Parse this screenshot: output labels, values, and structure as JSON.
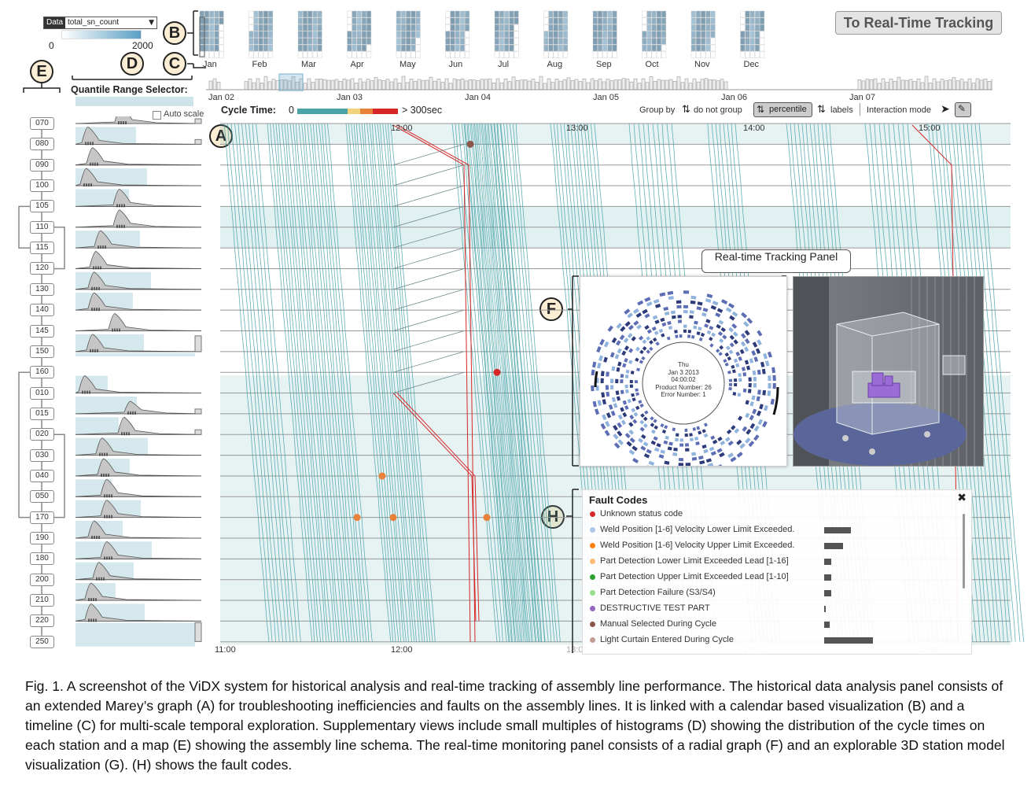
{
  "data_selector": {
    "tag": "Data",
    "value": "total_sn_count",
    "min": "0",
    "max": "2000"
  },
  "callouts": {
    "A": "A",
    "B": "B",
    "C": "C",
    "D": "D",
    "E": "E",
    "F": "F",
    "G": "G",
    "H": "H"
  },
  "realtime_button": "To Real-Time Tracking",
  "months": [
    "Jan",
    "Feb",
    "Mar",
    "Apr",
    "May",
    "Jun",
    "Jul",
    "Aug",
    "Sep",
    "Oct",
    "Nov",
    "Dec"
  ],
  "timeline_days": [
    "Jan 02",
    "Jan 03",
    "Jan 04",
    "Jan 05",
    "Jan 06",
    "Jan 07"
  ],
  "quantile_label": "Quantile Range Selector:",
  "auto_scale": "Auto scale",
  "cycle_time": {
    "label": "Cycle Time:",
    "min": "0",
    "max": "> 300sec",
    "colors": [
      "#4ba3a8",
      "#f2d27a",
      "#e8823a",
      "#d62728"
    ]
  },
  "toolbar": {
    "group_by": "Group by",
    "do_not_group": "do not group",
    "percentile": "percentile",
    "labels": "labels",
    "interaction_mode": "Interaction mode"
  },
  "hours_top": [
    "12:00",
    "13:00",
    "14:00",
    "15:00"
  ],
  "hours_bottom": [
    "11:00",
    "12:00",
    "13:00",
    "14:00",
    "15:00"
  ],
  "stations": [
    "070",
    "080",
    "090",
    "100",
    "105",
    "110",
    "115",
    "120",
    "130",
    "140",
    "145",
    "150",
    "160",
    "010",
    "015",
    "020",
    "030",
    "040",
    "050",
    "170",
    "190",
    "180",
    "200",
    "210",
    "220",
    "250"
  ],
  "realtime_panel_title": "Real-time Tracking Panel",
  "radial_center": {
    "day": "Thu",
    "date": "Jan 3 2013",
    "time": "04:00:02",
    "product": "Product Number: 26",
    "error": "Error Number: 1"
  },
  "fault_panel": {
    "title": "Fault Codes",
    "close": "✖",
    "items": [
      {
        "color": "#d62728",
        "label": "Unknown status code",
        "value": 0
      },
      {
        "color": "#aec7e8",
        "label": "Weld Position [1-6] Velocity Lower Limit Exceeded.",
        "value": 0.55
      },
      {
        "color": "#ff7f0e",
        "label": "Weld Position [1-6] Velocity Upper Limit Exceeded.",
        "value": 0.38
      },
      {
        "color": "#ffbb78",
        "label": "Part Detection Lower Limit Exceeded Lead [1-16]",
        "value": 0.14
      },
      {
        "color": "#2ca02c",
        "label": "Part Detection Upper Limit Exceeded Lead [1-10]",
        "value": 0.14
      },
      {
        "color": "#98df8a",
        "label": "Part Detection Failure (S3/S4)",
        "value": 0.14
      },
      {
        "color": "#9467bd",
        "label": "DESTRUCTIVE TEST PART",
        "value": 0.04
      },
      {
        "color": "#8c564b",
        "label": "Manual Selected During Cycle",
        "value": 0.12
      },
      {
        "color": "#c49c94",
        "label": "Light Curtain Entered During Cycle",
        "value": 1.0
      }
    ]
  },
  "caption": "Fig. 1. A screenshot of the ViDX system for historical analysis and real-time tracking of assembly line performance. The historical data analysis panel consists of an extended Marey’s graph (A) for troubleshooting inefficiencies and faults on the assembly lines. It is linked with a calendar based visualization (B) and a timeline (C) for multi-scale temporal exploration. Supplementary views include small multiples of histograms (D) showing the distribution of the cycle times on each station and a map (E) showing the assembly line schema. The real-time monitoring panel consists of a radial graph (F) and an explorable 3D station model visualization (G). (H) shows the fault codes."
}
